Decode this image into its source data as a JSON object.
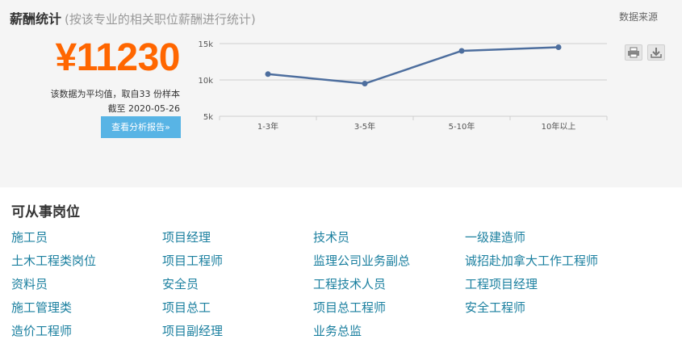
{
  "salary_section": {
    "title": "薪酬统计",
    "subtitle": "(按该专业的相关职位薪酬进行统计)",
    "data_source_label": "数据来源",
    "salary_value": "¥11230",
    "average_note": "该数据为平均值，取自33 份样本",
    "date_note": "截至 2020-05-26",
    "report_button_label": "查看分析报告»",
    "print_icon": "printer-icon",
    "download_icon": "download-icon"
  },
  "chart_data": {
    "type": "line",
    "categories": [
      "1-3年",
      "3-5年",
      "5-10年",
      "10年以上"
    ],
    "values": [
      10800,
      9500,
      14000,
      14500
    ],
    "ylim": [
      5000,
      15000
    ],
    "yticks": [
      5000,
      10000,
      15000
    ],
    "ytick_labels": [
      "5k",
      "10k",
      "15k"
    ],
    "grid": true,
    "line_color": "#4d6e9e",
    "title": "",
    "xlabel": "",
    "ylabel": ""
  },
  "jobs_section": {
    "title": "可从事岗位",
    "link_color": "#1a7f9f",
    "columns": [
      [
        "施工员",
        "土木工程类岗位",
        "资料员",
        "施工管理类",
        "造价工程师"
      ],
      [
        "项目经理",
        "项目工程师",
        "安全员",
        "项目总工",
        "项目副经理"
      ],
      [
        "技术员",
        "监理公司业务副总",
        "工程技术人员",
        "项目总工程师",
        "业务总监"
      ],
      [
        "一级建造师",
        "诚招赴加拿大工作工程师",
        "工程项目经理",
        "安全工程师"
      ]
    ]
  }
}
